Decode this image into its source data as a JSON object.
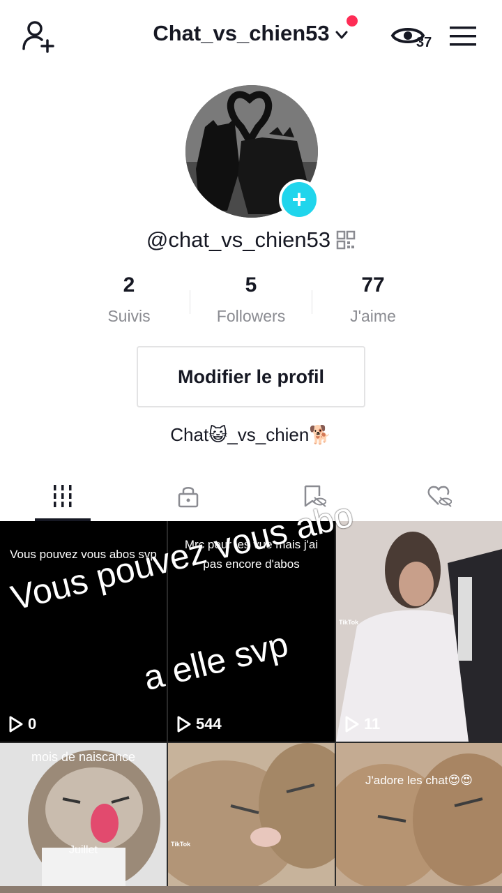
{
  "header": {
    "username": "Chat_vs_chien53",
    "profile_views": "37"
  },
  "profile": {
    "handle": "@chat_vs_chien53",
    "stats": [
      {
        "value": "2",
        "label": "Suivis"
      },
      {
        "value": "5",
        "label": "Followers"
      },
      {
        "value": "77",
        "label": "J'aime"
      }
    ],
    "edit_button": "Modifier le profil",
    "bio": "Chat😺_vs_chien🐕"
  },
  "tabs": [
    "videos-grid-icon",
    "lock-icon",
    "bookmark-hidden-icon",
    "liked-hidden-icon"
  ],
  "videos": [
    {
      "text": "Vous pouvez vous abos svp",
      "views": "0"
    },
    {
      "text": "Mrc pour les vue mais j'ai pas encore d'abos",
      "views": "544"
    },
    {
      "text": "",
      "views": "11",
      "watermark": "TikTok"
    },
    {
      "text": "mois de naiscance",
      "subtext": "Juillet",
      "views": ""
    },
    {
      "text": "",
      "views": "",
      "watermark": "TikTok"
    },
    {
      "text": "J'adore les chat😍😍",
      "views": ""
    }
  ],
  "overlay": {
    "line1": "Vous pouvez vous abo",
    "line2": "a elle svp"
  },
  "colors": {
    "accent": "#fe2c55",
    "plus_badge": "#20d5ec",
    "text_primary": "#161823",
    "text_secondary": "#8a8b91"
  }
}
